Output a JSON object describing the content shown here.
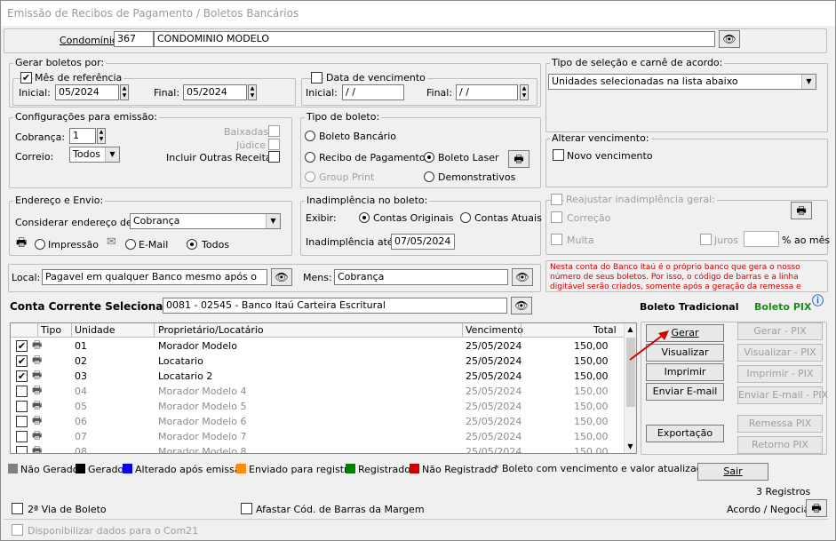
{
  "window": {
    "title": "Emissão de Recibos de Pagamento / Boletos Bancários"
  },
  "condominio": {
    "label": "Condomínio:",
    "code": "367",
    "name": "CONDOMINIO MODELO"
  },
  "gerar": {
    "group": "Gerar boletos por:",
    "mes_ref": {
      "label": "Mês de referência",
      "checked": true,
      "inicial_label": "Inicial:",
      "inicial": "05/2024",
      "final_label": "Final:",
      "final": "05/2024"
    },
    "data_venc": {
      "label": "Data de vencimento",
      "checked": false,
      "inicial_label": "Inicial:",
      "inicial": "  /  /",
      "final_label": "Final:",
      "final": "  /  /"
    }
  },
  "tipo_selecao": {
    "group": "Tipo de seleção e carnê de acordo:",
    "value": "Unidades selecionadas na lista abaixo"
  },
  "config": {
    "group": "Configurações para emissão:",
    "cobranca_label": "Cobrança:",
    "cobranca": "1",
    "correio_label": "Correio:",
    "correio": "Todos",
    "baixadas": "Baixadas",
    "judice": "Júdice",
    "incluir": "Incluir Outras Receitas"
  },
  "tipo_boleto": {
    "group": "Tipo de boleto:",
    "bancario": "Boleto Bancário",
    "recibo": "Recibo de Pagamento",
    "laser": "Boleto Laser",
    "group_print": "Group Print",
    "demonstrativos": "Demonstrativos"
  },
  "alterar_venc": {
    "group": "Alterar vencimento:",
    "novo": "Novo vencimento"
  },
  "endereco": {
    "group": "Endereço e Envio:",
    "considerar_label": "Considerar endereço de:",
    "considerar": "Cobrança",
    "impressao": "Impressão",
    "email": "E-Mail",
    "todos": "Todos"
  },
  "inadimplencia": {
    "group": "Inadimplência no boleto:",
    "exibir_label": "Exibir:",
    "originais": "Contas Originais",
    "atuais": "Contas Atuais",
    "ate_label": "Inadimplência até:",
    "ate": "07/05/2024"
  },
  "reajustar": {
    "label": "Reajustar inadimplência geral:",
    "correcao": "Correção",
    "multa": "Multa",
    "juros": "Juros",
    "juros_value": "",
    "ao_mes": "% ao mês"
  },
  "local": {
    "label": "Local:",
    "value": "Pagavel em qualquer Banco mesmo após o",
    "mens_label": "Mens:",
    "mens": "Cobrança"
  },
  "note": "Nesta conta do Banco Itaú é o próprio banco que gera o nosso número de seus boletos. Por isso, o código de barras e a linha digitável serão criados, somente após a geração da remessa e retorno com os registros.",
  "conta": {
    "label": "Conta Corrente Selecionada:",
    "value": "0081 - 02545 - Banco Itaú Carteira Escritural",
    "tradicional": "Boleto Tradicional",
    "pix": "Boleto PIX"
  },
  "table": {
    "headers": [
      "Tipo",
      "Unidade",
      "Proprietário/Locatário",
      "Vencimento",
      "Total"
    ],
    "rows": [
      {
        "checked": true,
        "unidade": "01",
        "nome": "Morador Modelo",
        "venc": "25/05/2024",
        "total": "150,00"
      },
      {
        "checked": true,
        "unidade": "02",
        "nome": "Locatario",
        "venc": "25/05/2024",
        "total": "150,00"
      },
      {
        "checked": true,
        "unidade": "03",
        "nome": "Locatario 2",
        "venc": "25/05/2024",
        "total": "150,00"
      },
      {
        "checked": false,
        "unidade": "04",
        "nome": "Morador Modelo 4",
        "venc": "25/05/2024",
        "total": "150,00"
      },
      {
        "checked": false,
        "unidade": "05",
        "nome": "Morador Modelo 5",
        "venc": "25/05/2024",
        "total": "150,00"
      },
      {
        "checked": false,
        "unidade": "06",
        "nome": "Morador Modelo 6",
        "venc": "25/05/2024",
        "total": "150,00"
      },
      {
        "checked": false,
        "unidade": "07",
        "nome": "Morador Modelo 7",
        "venc": "25/05/2024",
        "total": "150,00"
      },
      {
        "checked": false,
        "unidade": "08",
        "nome": "Morador Modelo 8",
        "venc": "25/05/2024",
        "total": "150,00"
      }
    ]
  },
  "buttons": {
    "gerar": "Gerar",
    "visualizar": "Visualizar",
    "imprimir": "Imprimir",
    "enviar": "Enviar E-mail",
    "exportacao": "Exportação",
    "gerar_pix": "Gerar - PIX",
    "visualizar_pix": "Visualizar - PIX",
    "imprimir_pix": "Imprimir - PIX",
    "enviar_pix": "Enviar E-mail - PIX",
    "remessa_pix": "Remessa PIX",
    "retorno_pix": "Retorno PIX",
    "sair": "Sair"
  },
  "legend": [
    {
      "label": "Não Gerado",
      "color": "#808080"
    },
    {
      "label": "Gerado",
      "color": "#000000"
    },
    {
      "label": "Alterado após emissão",
      "color": "#0000ff"
    },
    {
      "label": "Enviado para registro",
      "color": "#ff8c00"
    },
    {
      "label": "Registrado",
      "color": "#008000"
    },
    {
      "label": "Não Registrado",
      "color": "#cc0000"
    }
  ],
  "legend_note": "* Boleto com vencimento e valor atualizados.",
  "registros": "3 Registros",
  "bottom": {
    "segunda_via": "2ª Via de Boleto",
    "afastar": "Afastar Cód. de Barras da Margem",
    "acordo": "Acordo / Negociar",
    "disponibilizar": "Disponibilizar dados para o Com21"
  }
}
